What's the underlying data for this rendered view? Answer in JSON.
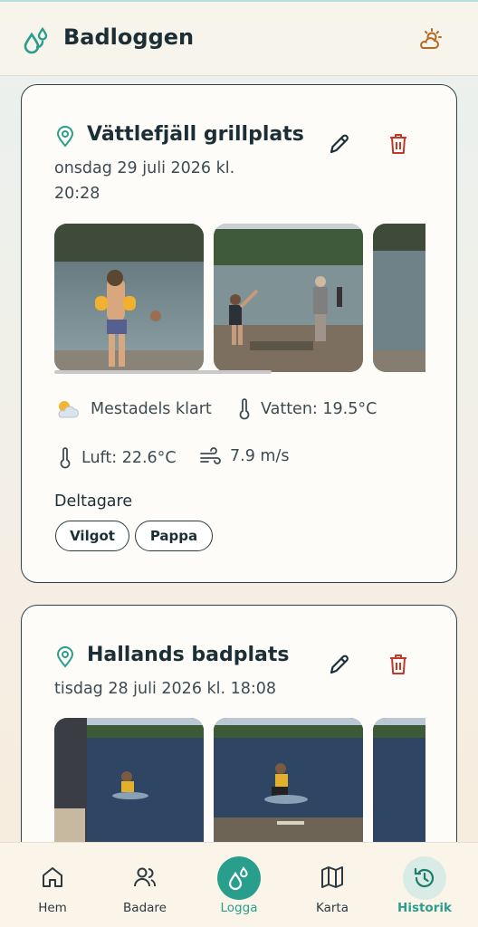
{
  "app": {
    "title": "Badloggen"
  },
  "entries": [
    {
      "place": "Vättlefjäll grillplats",
      "date_line1": "onsdag 29 juli 2026 kl.",
      "date_line2": "20:28",
      "weather": "Mestadels klart",
      "water": "Vatten: 19.5°C",
      "air": "Luft: 22.6°C",
      "wind": "7.9 m/s",
      "participants_label": "Deltagare",
      "participants": [
        "Vilgot",
        "Pappa"
      ],
      "photos": [
        "child-armbands-lake-photo",
        "people-throwing-stones-photo",
        "lake-partial-photo"
      ]
    },
    {
      "place": "Hallands badplats",
      "date_line1": "tisdag 28 juli 2026 kl. 18:08",
      "photos": [
        "adult-and-child-swimming-photo",
        "child-jumping-from-pier-photo",
        "lake-partial-photo"
      ]
    }
  ],
  "nav": {
    "items": [
      {
        "label": "Hem",
        "icon": "home-icon"
      },
      {
        "label": "Badare",
        "icon": "people-icon"
      },
      {
        "label": "Logga",
        "icon": "drops-icon"
      },
      {
        "label": "Karta",
        "icon": "map-icon"
      },
      {
        "label": "Historik",
        "icon": "history-icon"
      }
    ],
    "active": "Historik",
    "accent": "#2a9e8c"
  },
  "colors": {
    "accent": "#2a9e8c",
    "delete": "#c0392b",
    "header_bg": "#f7f4ec"
  }
}
